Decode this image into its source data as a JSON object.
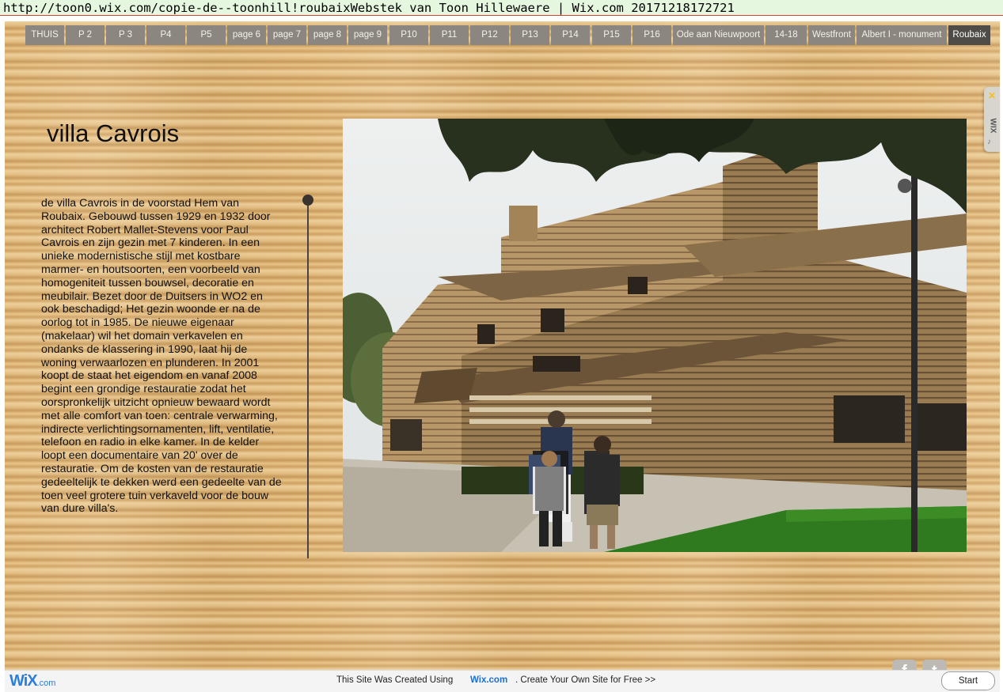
{
  "address_bar": {
    "text": "http://toon0.wix.com/copie-de--toonhill!roubaixWebstek van Toon Hillewaere | Wix.com 20171218172721"
  },
  "nav": {
    "items": [
      "THUIS",
      "P 2",
      "P 3",
      "P4",
      "P5",
      "page 6",
      "page 7",
      "page 8",
      "page 9",
      "P10",
      "P11",
      "P12",
      "P13",
      "P14",
      "P15",
      "P16",
      "Ode aan Nieuwpoort",
      "14-18",
      "Westfront",
      "Albert  I - monument",
      "Roubaix"
    ],
    "active": "Roubaix"
  },
  "page": {
    "title": "villa Cavrois",
    "text": "de villa Cavrois in de voorstad Hem van Roubaix. Gebouwd tussen 1929 en 1932 door architect Robert Mallet-Stevens voor Paul Cavrois en zijn gezin met 7 kinderen. In een unieke modernistische stijl met kostbare marmer- en houtsoorten, een voorbeeld van homogeniteit tussen bouwsel, decoratie en meubilair. Bezet door de Duitsers in WO2 en ook beschadigd; Het gezin woonde er na de oorlog tot in 1985. De nieuwe eigenaar (makelaar) wil het domain verkavelen en ondanks de klassering in 1990, laat hij de woning verwaarlozen en plunderen. In 2001 koopt de staat het eigendom en vanaf 2008 begint een grondige restauratie zodat het oorspronkelijk uitzicht opnieuw bewaard wordt met alle comfort van toen: centrale verwarming, indirecte verlichtingsornamenten, lift, ventilatie, telefoon en radio in elke kamer. In de kelder loopt een documentaire van 20' over de restauratie. Om de kosten van de restauratie gedeeltelijk te dekken werd een gedeelte van de toen veel grotere tuin verkaveld voor de bouw van dure villa's."
  },
  "wix_tab": {
    "label": "WIX"
  },
  "social": {
    "facebook": "f",
    "twitter": "t"
  },
  "footer": {
    "logo": "WiX",
    "logo_suffix": ".com",
    "text_before": "This Site Was Created Using",
    "link": "Wix.com",
    "text_after": ". Create Your Own Site for Free >>",
    "start_button": "Start"
  },
  "colors": {
    "nav_bg": "#8b8680",
    "nav_active": "#4f4c47",
    "wix_blue": "#2d7ed8"
  }
}
